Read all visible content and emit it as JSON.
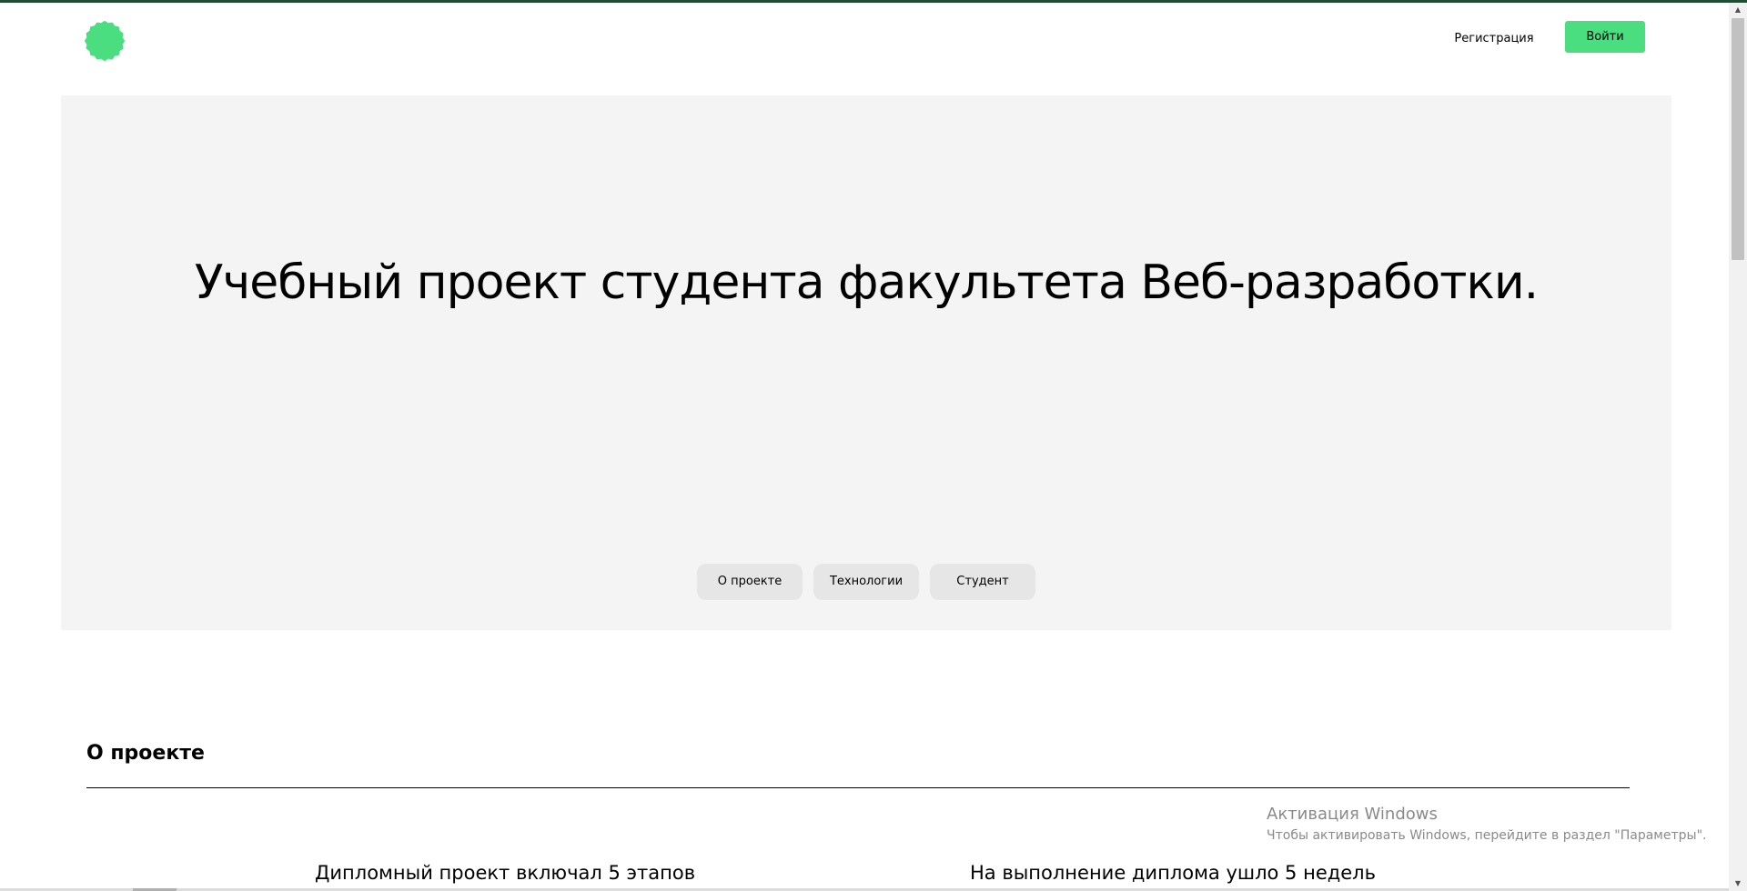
{
  "header": {
    "logo_icon": "flower-badge-icon",
    "register_label": "Регистрация",
    "login_label": "Войти"
  },
  "hero": {
    "title": "Учебный проект студента факультета Веб-разработки.",
    "tabs": [
      {
        "label": "О проекте"
      },
      {
        "label": "Технологии"
      },
      {
        "label": "Студент"
      }
    ]
  },
  "about": {
    "title": "О проекте",
    "stages_title": "Дипломный проект включал 5 этапов",
    "weeks_title": "На выполнение диплома ушло 5 недель"
  },
  "os_overlay": {
    "title": "Активация Windows",
    "subtitle": "Чтобы активировать Windows, перейдите в раздел \"Параметры\"."
  },
  "colors": {
    "accent": "#4ade80",
    "hero_background": "#f4f4f4",
    "tab_background": "#e6e6e6",
    "top_strip": "#1f4d33"
  }
}
